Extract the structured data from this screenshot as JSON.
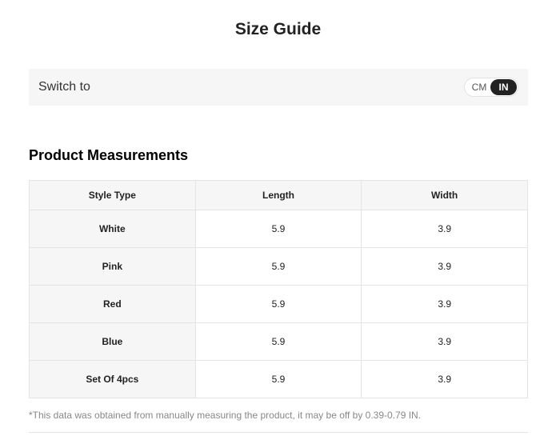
{
  "page": {
    "title": "Size Guide"
  },
  "switch": {
    "label": "Switch to",
    "options": [
      "CM",
      "IN"
    ],
    "selected": "IN"
  },
  "section": {
    "title": "Product Measurements"
  },
  "table": {
    "headers": [
      "Style Type",
      "Length",
      "Width"
    ],
    "rows": [
      [
        "White",
        "5.9",
        "3.9"
      ],
      [
        "Pink",
        "5.9",
        "3.9"
      ],
      [
        "Red",
        "5.9",
        "3.9"
      ],
      [
        "Blue",
        "5.9",
        "3.9"
      ],
      [
        "Set Of 4pcs",
        "5.9",
        "3.9"
      ]
    ]
  },
  "footnote": "*This data was obtained from manually measuring the product, it may be off by 0.39-0.79 IN.",
  "colors": {
    "toggle_active_bg": "#222222",
    "panel_bg": "#f6f6f6"
  }
}
